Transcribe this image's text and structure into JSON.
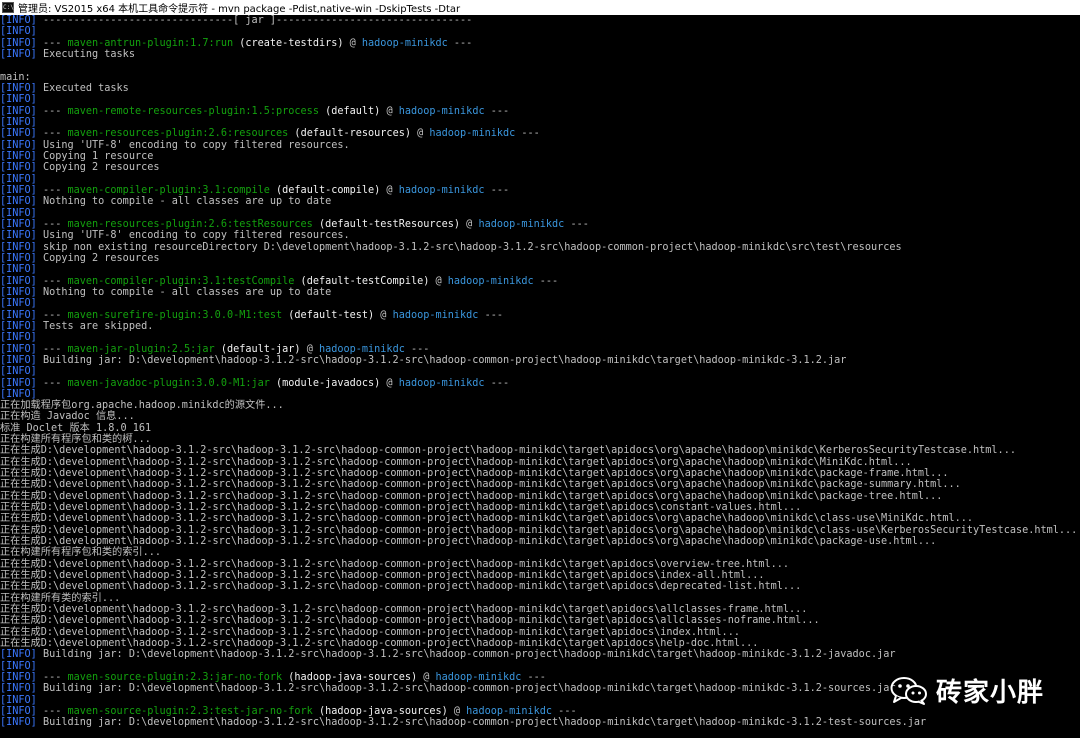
{
  "window": {
    "title": "管理员: VS2015 x64 本机工具命令提示符 - mvn  package -Pdist,native-win -DskipTests -Dtar",
    "icon": "console-app-icon"
  },
  "colors": {
    "background": "#000000",
    "text": "#c0c0c0",
    "info_tag": "#3b78ff",
    "plugin": "#13a10e",
    "goal_id": "#f2f2f2",
    "artifact": "#3a96dd"
  },
  "console": {
    "lines": [
      [
        {
          "c": "info",
          "t": "[INFO]"
        },
        {
          "c": "",
          "t": " -------------------------------[ jar ]--------------------------------"
        }
      ],
      [
        {
          "c": "info",
          "t": "[INFO]"
        }
      ],
      [
        {
          "c": "info",
          "t": "[INFO]"
        },
        {
          "c": "",
          "t": " --- "
        },
        {
          "c": "plugin",
          "t": "maven-antrun-plugin:1.7:run"
        },
        {
          "c": "bold",
          "t": " (create-testdirs)"
        },
        {
          "c": "",
          "t": " @ "
        },
        {
          "c": "artifact",
          "t": "hadoop-minikdc"
        },
        {
          "c": "",
          "t": " ---"
        }
      ],
      [
        {
          "c": "info",
          "t": "[INFO]"
        },
        {
          "c": "",
          "t": " Executing tasks"
        }
      ],
      [],
      [
        {
          "c": "",
          "t": "main:"
        }
      ],
      [
        {
          "c": "info",
          "t": "[INFO]"
        },
        {
          "c": "",
          "t": " Executed tasks"
        }
      ],
      [
        {
          "c": "info",
          "t": "[INFO]"
        }
      ],
      [
        {
          "c": "info",
          "t": "[INFO]"
        },
        {
          "c": "",
          "t": " --- "
        },
        {
          "c": "plugin",
          "t": "maven-remote-resources-plugin:1.5:process"
        },
        {
          "c": "bold",
          "t": " (default)"
        },
        {
          "c": "",
          "t": " @ "
        },
        {
          "c": "artifact",
          "t": "hadoop-minikdc"
        },
        {
          "c": "",
          "t": " ---"
        }
      ],
      [
        {
          "c": "info",
          "t": "[INFO]"
        }
      ],
      [
        {
          "c": "info",
          "t": "[INFO]"
        },
        {
          "c": "",
          "t": " --- "
        },
        {
          "c": "plugin",
          "t": "maven-resources-plugin:2.6:resources"
        },
        {
          "c": "bold",
          "t": " (default-resources)"
        },
        {
          "c": "",
          "t": " @ "
        },
        {
          "c": "artifact",
          "t": "hadoop-minikdc"
        },
        {
          "c": "",
          "t": " ---"
        }
      ],
      [
        {
          "c": "info",
          "t": "[INFO]"
        },
        {
          "c": "",
          "t": " Using 'UTF-8' encoding to copy filtered resources."
        }
      ],
      [
        {
          "c": "info",
          "t": "[INFO]"
        },
        {
          "c": "",
          "t": " Copying 1 resource"
        }
      ],
      [
        {
          "c": "info",
          "t": "[INFO]"
        },
        {
          "c": "",
          "t": " Copying 2 resources"
        }
      ],
      [
        {
          "c": "info",
          "t": "[INFO]"
        }
      ],
      [
        {
          "c": "info",
          "t": "[INFO]"
        },
        {
          "c": "",
          "t": " --- "
        },
        {
          "c": "plugin",
          "t": "maven-compiler-plugin:3.1:compile"
        },
        {
          "c": "bold",
          "t": " (default-compile)"
        },
        {
          "c": "",
          "t": " @ "
        },
        {
          "c": "artifact",
          "t": "hadoop-minikdc"
        },
        {
          "c": "",
          "t": " ---"
        }
      ],
      [
        {
          "c": "info",
          "t": "[INFO]"
        },
        {
          "c": "",
          "t": " Nothing to compile - all classes are up to date"
        }
      ],
      [
        {
          "c": "info",
          "t": "[INFO]"
        }
      ],
      [
        {
          "c": "info",
          "t": "[INFO]"
        },
        {
          "c": "",
          "t": " --- "
        },
        {
          "c": "plugin",
          "t": "maven-resources-plugin:2.6:testResources"
        },
        {
          "c": "bold",
          "t": " (default-testResources)"
        },
        {
          "c": "",
          "t": " @ "
        },
        {
          "c": "artifact",
          "t": "hadoop-minikdc"
        },
        {
          "c": "",
          "t": " ---"
        }
      ],
      [
        {
          "c": "info",
          "t": "[INFO]"
        },
        {
          "c": "",
          "t": " Using 'UTF-8' encoding to copy filtered resources."
        }
      ],
      [
        {
          "c": "info",
          "t": "[INFO]"
        },
        {
          "c": "",
          "t": " skip non existing resourceDirectory D:\\development\\hadoop-3.1.2-src\\hadoop-3.1.2-src\\hadoop-common-project\\hadoop-minikdc\\src\\test\\resources"
        }
      ],
      [
        {
          "c": "info",
          "t": "[INFO]"
        },
        {
          "c": "",
          "t": " Copying 2 resources"
        }
      ],
      [
        {
          "c": "info",
          "t": "[INFO]"
        }
      ],
      [
        {
          "c": "info",
          "t": "[INFO]"
        },
        {
          "c": "",
          "t": " --- "
        },
        {
          "c": "plugin",
          "t": "maven-compiler-plugin:3.1:testCompile"
        },
        {
          "c": "bold",
          "t": " (default-testCompile)"
        },
        {
          "c": "",
          "t": " @ "
        },
        {
          "c": "artifact",
          "t": "hadoop-minikdc"
        },
        {
          "c": "",
          "t": " ---"
        }
      ],
      [
        {
          "c": "info",
          "t": "[INFO]"
        },
        {
          "c": "",
          "t": " Nothing to compile - all classes are up to date"
        }
      ],
      [
        {
          "c": "info",
          "t": "[INFO]"
        }
      ],
      [
        {
          "c": "info",
          "t": "[INFO]"
        },
        {
          "c": "",
          "t": " --- "
        },
        {
          "c": "plugin",
          "t": "maven-surefire-plugin:3.0.0-M1:test"
        },
        {
          "c": "bold",
          "t": " (default-test)"
        },
        {
          "c": "",
          "t": " @ "
        },
        {
          "c": "artifact",
          "t": "hadoop-minikdc"
        },
        {
          "c": "",
          "t": " ---"
        }
      ],
      [
        {
          "c": "info",
          "t": "[INFO]"
        },
        {
          "c": "",
          "t": " Tests are skipped."
        }
      ],
      [
        {
          "c": "info",
          "t": "[INFO]"
        }
      ],
      [
        {
          "c": "info",
          "t": "[INFO]"
        },
        {
          "c": "",
          "t": " --- "
        },
        {
          "c": "plugin",
          "t": "maven-jar-plugin:2.5:jar"
        },
        {
          "c": "bold",
          "t": " (default-jar)"
        },
        {
          "c": "",
          "t": " @ "
        },
        {
          "c": "artifact",
          "t": "hadoop-minikdc"
        },
        {
          "c": "",
          "t": " ---"
        }
      ],
      [
        {
          "c": "info",
          "t": "[INFO]"
        },
        {
          "c": "",
          "t": " Building jar: D:\\development\\hadoop-3.1.2-src\\hadoop-3.1.2-src\\hadoop-common-project\\hadoop-minikdc\\target\\hadoop-minikdc-3.1.2.jar"
        }
      ],
      [
        {
          "c": "info",
          "t": "[INFO]"
        }
      ],
      [
        {
          "c": "info",
          "t": "[INFO]"
        },
        {
          "c": "",
          "t": " --- "
        },
        {
          "c": "plugin",
          "t": "maven-javadoc-plugin:3.0.0-M1:jar"
        },
        {
          "c": "bold",
          "t": " (module-javadocs)"
        },
        {
          "c": "",
          "t": " @ "
        },
        {
          "c": "artifact",
          "t": "hadoop-minikdc"
        },
        {
          "c": "",
          "t": " ---"
        }
      ],
      [
        {
          "c": "info",
          "t": "[INFO]"
        }
      ],
      [
        {
          "c": "",
          "t": "正在加载程序包org.apache.hadoop.minikdc的源文件..."
        }
      ],
      [
        {
          "c": "",
          "t": "正在构造 Javadoc 信息..."
        }
      ],
      [
        {
          "c": "",
          "t": "标准 Doclet 版本 1.8.0_161"
        }
      ],
      [
        {
          "c": "",
          "t": "正在构建所有程序包和类的树..."
        }
      ],
      [
        {
          "c": "",
          "t": "正在生成D:\\development\\hadoop-3.1.2-src\\hadoop-3.1.2-src\\hadoop-common-project\\hadoop-minikdc\\target\\apidocs\\org\\apache\\hadoop\\minikdc\\KerberosSecurityTestcase.html..."
        }
      ],
      [
        {
          "c": "",
          "t": "正在生成D:\\development\\hadoop-3.1.2-src\\hadoop-3.1.2-src\\hadoop-common-project\\hadoop-minikdc\\target\\apidocs\\org\\apache\\hadoop\\minikdc\\MiniKdc.html..."
        }
      ],
      [
        {
          "c": "",
          "t": "正在生成D:\\development\\hadoop-3.1.2-src\\hadoop-3.1.2-src\\hadoop-common-project\\hadoop-minikdc\\target\\apidocs\\org\\apache\\hadoop\\minikdc\\package-frame.html..."
        }
      ],
      [
        {
          "c": "",
          "t": "正在生成D:\\development\\hadoop-3.1.2-src\\hadoop-3.1.2-src\\hadoop-common-project\\hadoop-minikdc\\target\\apidocs\\org\\apache\\hadoop\\minikdc\\package-summary.html..."
        }
      ],
      [
        {
          "c": "",
          "t": "正在生成D:\\development\\hadoop-3.1.2-src\\hadoop-3.1.2-src\\hadoop-common-project\\hadoop-minikdc\\target\\apidocs\\org\\apache\\hadoop\\minikdc\\package-tree.html..."
        }
      ],
      [
        {
          "c": "",
          "t": "正在生成D:\\development\\hadoop-3.1.2-src\\hadoop-3.1.2-src\\hadoop-common-project\\hadoop-minikdc\\target\\apidocs\\constant-values.html..."
        }
      ],
      [
        {
          "c": "",
          "t": "正在生成D:\\development\\hadoop-3.1.2-src\\hadoop-3.1.2-src\\hadoop-common-project\\hadoop-minikdc\\target\\apidocs\\org\\apache\\hadoop\\minikdc\\class-use\\MiniKdc.html..."
        }
      ],
      [
        {
          "c": "",
          "t": "正在生成D:\\development\\hadoop-3.1.2-src\\hadoop-3.1.2-src\\hadoop-common-project\\hadoop-minikdc\\target\\apidocs\\org\\apache\\hadoop\\minikdc\\class-use\\KerberosSecurityTestcase.html..."
        }
      ],
      [
        {
          "c": "",
          "t": "正在生成D:\\development\\hadoop-3.1.2-src\\hadoop-3.1.2-src\\hadoop-common-project\\hadoop-minikdc\\target\\apidocs\\org\\apache\\hadoop\\minikdc\\package-use.html..."
        }
      ],
      [
        {
          "c": "",
          "t": "正在构建所有程序包和类的索引..."
        }
      ],
      [
        {
          "c": "",
          "t": "正在生成D:\\development\\hadoop-3.1.2-src\\hadoop-3.1.2-src\\hadoop-common-project\\hadoop-minikdc\\target\\apidocs\\overview-tree.html..."
        }
      ],
      [
        {
          "c": "",
          "t": "正在生成D:\\development\\hadoop-3.1.2-src\\hadoop-3.1.2-src\\hadoop-common-project\\hadoop-minikdc\\target\\apidocs\\index-all.html..."
        }
      ],
      [
        {
          "c": "",
          "t": "正在生成D:\\development\\hadoop-3.1.2-src\\hadoop-3.1.2-src\\hadoop-common-project\\hadoop-minikdc\\target\\apidocs\\deprecated-list.html..."
        }
      ],
      [
        {
          "c": "",
          "t": "正在构建所有类的索引..."
        }
      ],
      [
        {
          "c": "",
          "t": "正在生成D:\\development\\hadoop-3.1.2-src\\hadoop-3.1.2-src\\hadoop-common-project\\hadoop-minikdc\\target\\apidocs\\allclasses-frame.html..."
        }
      ],
      [
        {
          "c": "",
          "t": "正在生成D:\\development\\hadoop-3.1.2-src\\hadoop-3.1.2-src\\hadoop-common-project\\hadoop-minikdc\\target\\apidocs\\allclasses-noframe.html..."
        }
      ],
      [
        {
          "c": "",
          "t": "正在生成D:\\development\\hadoop-3.1.2-src\\hadoop-3.1.2-src\\hadoop-common-project\\hadoop-minikdc\\target\\apidocs\\index.html..."
        }
      ],
      [
        {
          "c": "",
          "t": "正在生成D:\\development\\hadoop-3.1.2-src\\hadoop-3.1.2-src\\hadoop-common-project\\hadoop-minikdc\\target\\apidocs\\help-doc.html..."
        }
      ],
      [
        {
          "c": "info",
          "t": "[INFO]"
        },
        {
          "c": "",
          "t": " Building jar: D:\\development\\hadoop-3.1.2-src\\hadoop-3.1.2-src\\hadoop-common-project\\hadoop-minikdc\\target\\hadoop-minikdc-3.1.2-javadoc.jar"
        }
      ],
      [
        {
          "c": "info",
          "t": "[INFO]"
        }
      ],
      [
        {
          "c": "info",
          "t": "[INFO]"
        },
        {
          "c": "",
          "t": " --- "
        },
        {
          "c": "plugin",
          "t": "maven-source-plugin:2.3:jar-no-fork"
        },
        {
          "c": "bold",
          "t": " (hadoop-java-sources)"
        },
        {
          "c": "",
          "t": " @ "
        },
        {
          "c": "artifact",
          "t": "hadoop-minikdc"
        },
        {
          "c": "",
          "t": " ---"
        }
      ],
      [
        {
          "c": "info",
          "t": "[INFO]"
        },
        {
          "c": "",
          "t": " Building jar: D:\\development\\hadoop-3.1.2-src\\hadoop-3.1.2-src\\hadoop-common-project\\hadoop-minikdc\\target\\hadoop-minikdc-3.1.2-sources.jar"
        }
      ],
      [
        {
          "c": "info",
          "t": "[INFO]"
        }
      ],
      [
        {
          "c": "info",
          "t": "[INFO]"
        },
        {
          "c": "",
          "t": " --- "
        },
        {
          "c": "plugin",
          "t": "maven-source-plugin:2.3:test-jar-no-fork"
        },
        {
          "c": "bold",
          "t": " (hadoop-java-sources)"
        },
        {
          "c": "",
          "t": " @ "
        },
        {
          "c": "artifact",
          "t": "hadoop-minikdc"
        },
        {
          "c": "",
          "t": " ---"
        }
      ],
      [
        {
          "c": "info",
          "t": "[INFO]"
        },
        {
          "c": "",
          "t": " Building jar: D:\\development\\hadoop-3.1.2-src\\hadoop-3.1.2-src\\hadoop-common-project\\hadoop-minikdc\\target\\hadoop-minikdc-3.1.2-test-sources.jar"
        }
      ]
    ]
  },
  "watermark": {
    "icon": "wechat-icon",
    "text": "砖家小胖"
  }
}
